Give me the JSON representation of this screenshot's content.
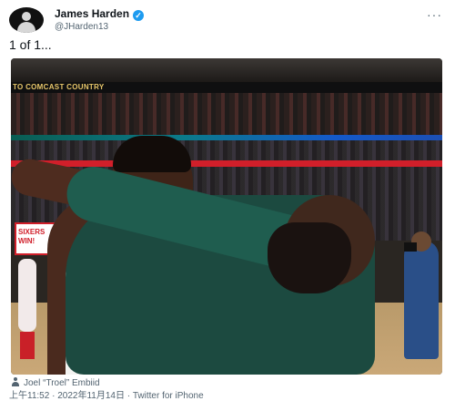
{
  "author": {
    "name": "James Harden",
    "handle": "@JHarden13",
    "verified_icon": "verified-badge-icon"
  },
  "more_icon": "more-options-icon",
  "tweet": {
    "text": "1 of 1..."
  },
  "photo": {
    "arena_banner": "TO COMCAST COUNTRY",
    "sign_text": "SIXERS WIN!"
  },
  "tagged": {
    "icon": "person-tag-icon",
    "name": "Joel “Troel” Embiid"
  },
  "meta": {
    "time": "上午11:52",
    "separator1": "·",
    "date": "2022年11月14日",
    "separator2": "·",
    "source": "Twitter for iPhone"
  },
  "colors": {
    "verified": "#1d9bf0",
    "secondary_text": "#536471",
    "primary_text": "#0f1419"
  }
}
